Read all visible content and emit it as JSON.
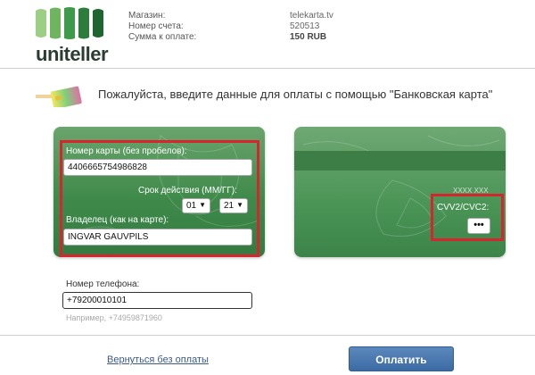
{
  "header": {
    "logo_text": "uniteller",
    "labels": [
      "Магазин:",
      "Номер счета:",
      "Сумма к оплате:"
    ],
    "values": [
      "telekarta.tv",
      "520513",
      "150 RUB"
    ]
  },
  "title": "Пожалуйста, введите данные для оплаты с помощью \"Банковская карта\"",
  "card_front": {
    "card_number_label": "Номер карты (без пробелов):",
    "card_number_value": "4406665754986828",
    "expiry_label": "Срок действия (ММ/ГГ):",
    "expiry_month": "01",
    "expiry_year": "21",
    "holder_label": "Владелец (как на карте):",
    "holder_value": "INGVAR GAUVPILS"
  },
  "card_back": {
    "signature_text": "XXXX XXX",
    "cvv_label": "CVV2/CVC2:",
    "cvv_value": "•••"
  },
  "phone": {
    "label": "Номер телефона:",
    "value": "+79200010101",
    "hint": "Например, +74959871960"
  },
  "footer": {
    "back_link": "Вернуться без оплаты",
    "pay_button": "Оплатить"
  },
  "colors": {
    "card_green": "#3f8a4b",
    "highlight_red": "#d7242e",
    "button_blue": "#3c6aa3",
    "link_blue": "#3a5a8a"
  }
}
